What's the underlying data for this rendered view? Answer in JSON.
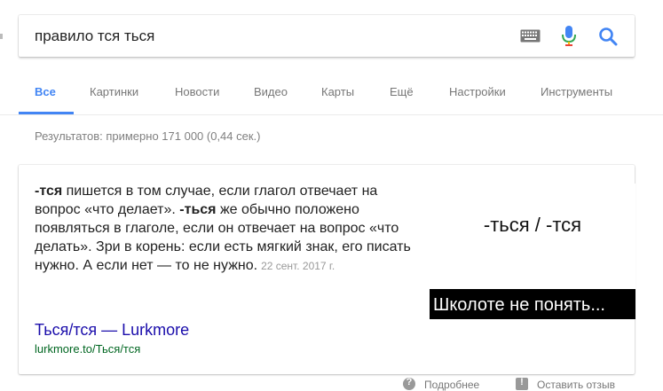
{
  "search": {
    "query": "правило тся ться"
  },
  "tabs": [
    {
      "label": "Все",
      "active": true
    },
    {
      "label": "Картинки"
    },
    {
      "label": "Новости"
    },
    {
      "label": "Видео"
    },
    {
      "label": "Карты"
    },
    {
      "label": "Ещё"
    },
    {
      "label": "Настройки"
    },
    {
      "label": "Инструменты"
    }
  ],
  "stats": "Результатов: примерно 171 000 (0,44 сек.)",
  "featured": {
    "snippet_parts": {
      "b1": "-тся",
      "t1": " пишется в том случае, если глагол отвечает на вопрос «что делает». ",
      "b2": "-ться",
      "t2": " же обычно положено появляться в глаголе, если он отвечает на вопрос «что делать». Зри в корень: если есть мягкий знак, его писать нужно. А если нет — то не нужно."
    },
    "date": "22 сент. 2017 г.",
    "title": "Ться/тся — Lurkmore",
    "url": "lurkmore.to/Ться/тся",
    "image_text_top": "-ться / -тся",
    "image_text_bottom": "Школоте не понять..."
  },
  "footer": {
    "more": "Подробнее",
    "feedback": "Оставить отзыв"
  },
  "colors": {
    "accent": "#4285f4",
    "link": "#1a0dab",
    "url": "#006621"
  }
}
